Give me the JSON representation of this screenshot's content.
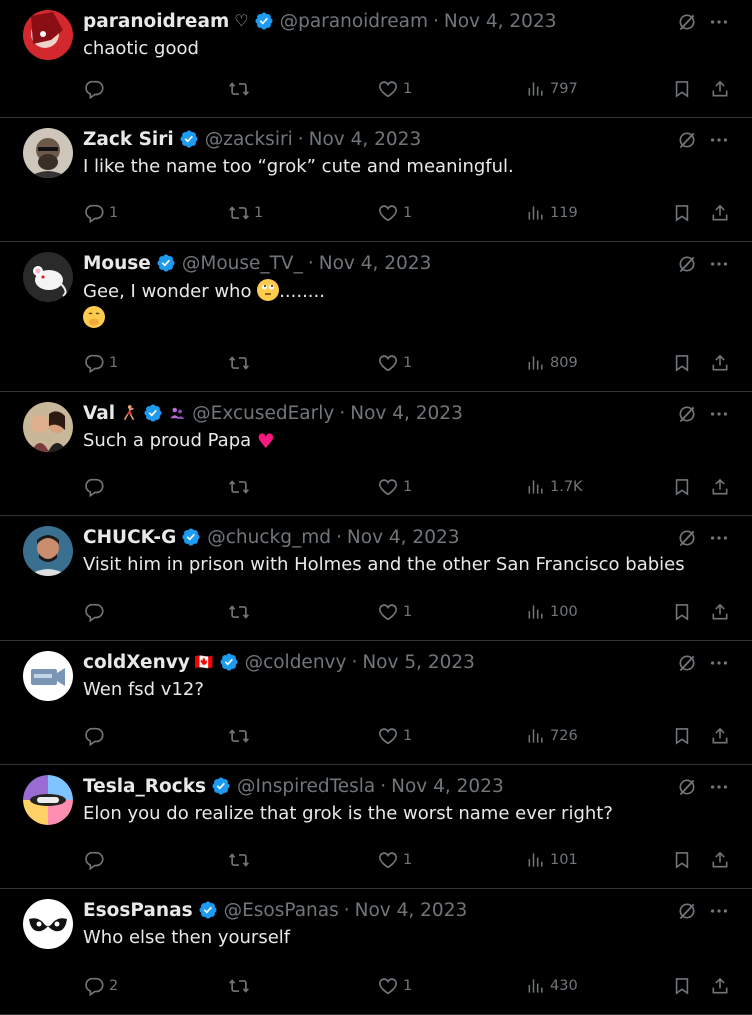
{
  "tweets": [
    {
      "name": "paranoidream",
      "name_suffix": "♡",
      "handle": "@paranoidream",
      "date": "Nov 4, 2023",
      "text": "chaotic good",
      "replies": "",
      "reposts": "",
      "likes": "1",
      "views": "797",
      "avatar_color": "#d4282f"
    },
    {
      "name": "Zack Siri",
      "handle": "@zacksiri",
      "date": "Nov 4, 2023",
      "text": "I like the name too “grok” cute and meaningful.",
      "replies": "1",
      "reposts": "1",
      "likes": "1",
      "views": "119",
      "avatar_color": "#6b5a4a"
    },
    {
      "name": "Mouse",
      "handle": "@Mouse_TV_",
      "date": "Nov 4, 2023",
      "text": "Gee, I wonder who ",
      "text_tail": "........",
      "replies": "1",
      "reposts": "",
      "likes": "1",
      "views": "809",
      "avatar_color": "#2a2a2a"
    },
    {
      "name": "Val",
      "handle": "@ExcusedEarly",
      "date": "Nov 4, 2023",
      "text": "Such a proud Papa ",
      "text_heart": "♥",
      "replies": "",
      "reposts": "",
      "likes": "1",
      "views": "1.7K",
      "avatar_color": "#7a3b3b"
    },
    {
      "name": "CHUCK-G",
      "handle": "@chuckg_md",
      "date": "Nov 4, 2023",
      "text": "Visit him in prison with Holmes and the other San Francisco babies",
      "replies": "",
      "reposts": "",
      "likes": "1",
      "views": "100",
      "avatar_color": "#3b6f8f"
    },
    {
      "name": "coldXenvy",
      "name_suffix": "🇨🇦",
      "handle": "@coldenvy",
      "date": "Nov 5, 2023",
      "text": "Wen fsd v12?",
      "replies": "",
      "reposts": "",
      "likes": "1",
      "views": "726",
      "avatar_color": "#ffffff"
    },
    {
      "name": "Tesla_Rocks",
      "handle": "@InspiredTesla",
      "date": "Nov 4, 2023",
      "text": "Elon you do realize that grok is the worst name ever right?",
      "replies": "",
      "reposts": "",
      "likes": "1",
      "views": "101",
      "avatar_color": "#9a6bd1"
    },
    {
      "name": "EsosPanas",
      "handle": "@EsosPanas",
      "date": "Nov 4, 2023",
      "text": "Who else then yourself",
      "replies": "2",
      "reposts": "",
      "likes": "1",
      "views": "430",
      "avatar_color": "#ffffff"
    }
  ],
  "colors": {
    "background": "#000000",
    "text": "#e7e9ea",
    "muted": "#71767b",
    "verified": "#1d9bf0",
    "divider": "#2f3336",
    "like_heart": "#f91880"
  },
  "icons": [
    "grok-icon",
    "more-icon",
    "reply-icon",
    "repost-icon",
    "like-icon",
    "views-icon",
    "bookmark-icon",
    "share-icon",
    "verified-badge-icon"
  ]
}
